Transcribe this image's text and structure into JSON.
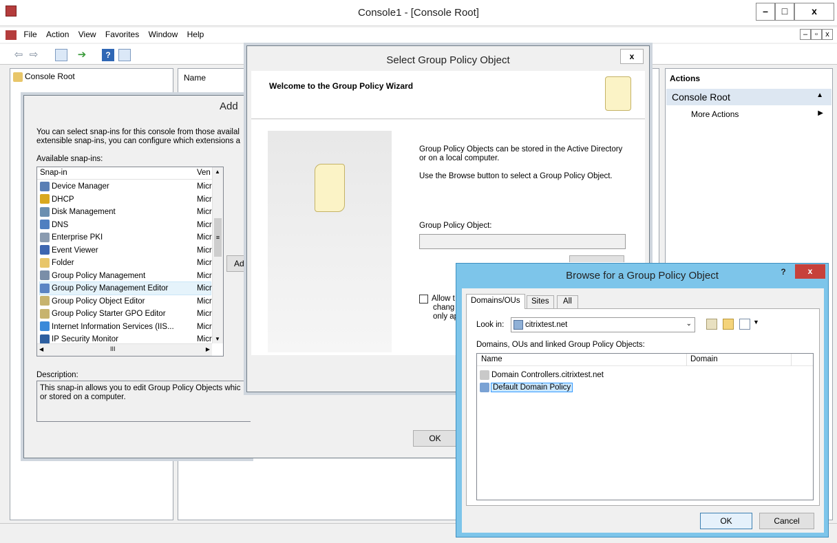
{
  "window": {
    "title": "Console1 - [Console Root]",
    "minimize": "–",
    "maximize": "□",
    "close": "x",
    "inner_min": "–",
    "inner_restore": "▫",
    "inner_close": "x"
  },
  "menu": [
    "File",
    "Action",
    "View",
    "Favorites",
    "Window",
    "Help"
  ],
  "tree": {
    "root": "Console Root"
  },
  "list": {
    "header_name": "Name"
  },
  "actions": {
    "header": "Actions",
    "section": "Console Root",
    "more": "More Actions"
  },
  "add_snapin": {
    "title_partial": "Add",
    "intro_line1": "You can select snap-ins for this console from those availal",
    "intro_line2": "extensible snap-ins, you can configure which extensions a",
    "available_label": "Available snap-ins:",
    "col_snapin": "Snap-in",
    "col_vendor": "Ven",
    "items": [
      {
        "name": "Device Manager",
        "vendor": "Micr",
        "color": "#5a7fb5"
      },
      {
        "name": "DHCP",
        "vendor": "Micr",
        "color": "#d9a81e"
      },
      {
        "name": "Disk Management",
        "vendor": "Micr",
        "color": "#6b8fb0"
      },
      {
        "name": "DNS",
        "vendor": "Micr",
        "color": "#4f7fc0"
      },
      {
        "name": "Enterprise PKI",
        "vendor": "Micr",
        "color": "#8a9bb0"
      },
      {
        "name": "Event Viewer",
        "vendor": "Micr",
        "color": "#3d66b0"
      },
      {
        "name": "Folder",
        "vendor": "Micr",
        "color": "#e8c66a"
      },
      {
        "name": "Group Policy Management",
        "vendor": "Micr",
        "color": "#7a8ea8"
      },
      {
        "name": "Group Policy Management Editor",
        "vendor": "Micr",
        "color": "#5b84c4"
      },
      {
        "name": "Group Policy Object Editor",
        "vendor": "Micr",
        "color": "#c7b36e"
      },
      {
        "name": "Group Policy Starter GPO Editor",
        "vendor": "Micr",
        "color": "#c7b36e"
      },
      {
        "name": "Internet Information Services (IIS...",
        "vendor": "Micr",
        "color": "#3b8ad9"
      },
      {
        "name": "IP Security Monitor",
        "vendor": "Micr",
        "color": "#2d5fa0"
      }
    ],
    "selected_index": 8,
    "scroll_mid": "III",
    "add_button_partial": "Ad",
    "description_label": "Description:",
    "description_line1": "This snap-in allows you to edit Group Policy Objects whic",
    "description_line2": "or stored on a computer.",
    "ok": "OK"
  },
  "gpo_wizard": {
    "title": "Select Group Policy Object",
    "close": "x",
    "welcome": "Welcome to the Group Policy Wizard",
    "desc1_line1": "Group Policy Objects can be stored in the Active Directory",
    "desc1_line2": "or on a local computer.",
    "desc2": "Use the Browse button to select a Group Policy Object.",
    "gpo_label": "Group Policy Object:",
    "gpo_value": "",
    "allow_line1": "Allow t",
    "allow_line2": "chang",
    "allow_line3": "only ap"
  },
  "browse": {
    "title": "Browse for a Group Policy Object",
    "help": "?",
    "close": "x",
    "tabs": [
      "Domains/OUs",
      "Sites",
      "All"
    ],
    "active_tab": 0,
    "look_in_label": "Look in:",
    "look_in_value": "citrixtest.net",
    "list_label": "Domains, OUs and linked Group Policy Objects:",
    "col_name": "Name",
    "col_domain": "Domain",
    "items": [
      {
        "name": "Domain Controllers.citrixtest.net",
        "selected": false
      },
      {
        "name": "Default Domain Policy",
        "selected": true
      }
    ],
    "ok": "OK",
    "cancel": "Cancel"
  }
}
